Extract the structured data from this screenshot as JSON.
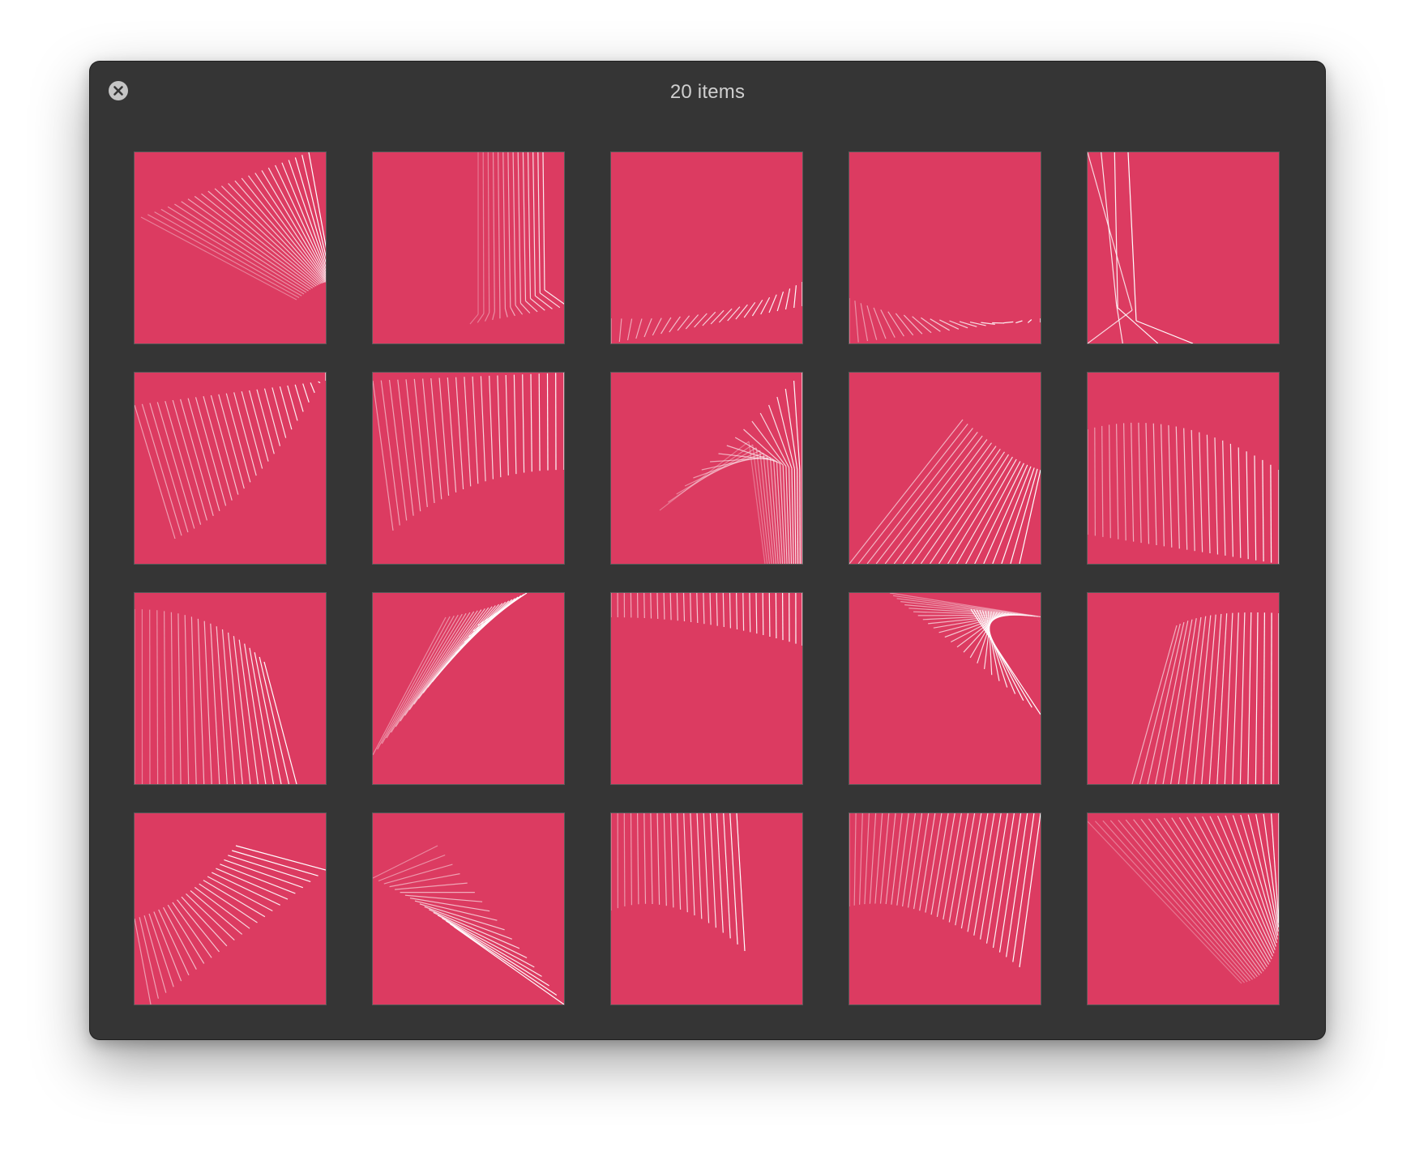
{
  "window": {
    "title": "20 items"
  },
  "icons": {
    "close": "close-icon"
  },
  "colors": {
    "window_bg": "#353535",
    "thumbnail_bg": "#dc3b61",
    "line_color": "#ffffff",
    "title_text": "#cfcfcf"
  },
  "grid": {
    "columns": 5,
    "rows": 4,
    "item_count": 20
  }
}
